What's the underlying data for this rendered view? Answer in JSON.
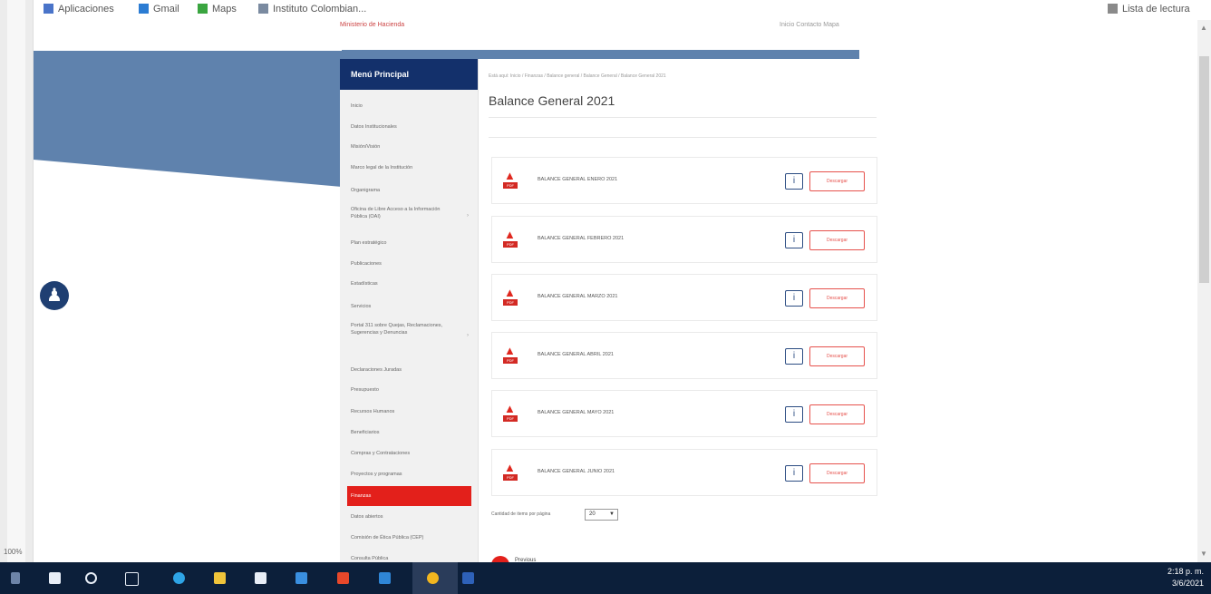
{
  "bookmarks": [
    {
      "label": "Aplicaciones",
      "icon": "apps-grid-icon",
      "color": "#4a74c9"
    },
    {
      "label": "Gmail",
      "icon": "gmail-icon",
      "color": "#2b7cd3"
    },
    {
      "label": "Maps",
      "icon": "maps-icon",
      "color": "#3aa540"
    },
    {
      "label": "Instituto Colombian...",
      "icon": "bookmark-site-icon",
      "color": "#7a8aa0"
    }
  ],
  "reading_list": "Lista de lectura",
  "zoom": "100%",
  "header": {
    "site_link": "Ministerio de Hacienda",
    "top_links": "Inicio   Contacto   Mapa"
  },
  "sidebar": {
    "title": "Menú Principal",
    "items": [
      {
        "label": "Inicio",
        "has_arrow": false
      },
      {
        "label": "Datos Institucionales",
        "has_arrow": false
      },
      {
        "label": "Misión/Visión",
        "has_arrow": false
      },
      {
        "label": "Marco legal de la Institución",
        "has_arrow": false
      },
      {
        "label": "Organigrama",
        "has_arrow": false
      },
      {
        "label": "Oficina de Libre Acceso a la Información Pública (OAI)",
        "has_arrow": true
      },
      {
        "label": "Plan estratégico",
        "has_arrow": false
      },
      {
        "label": "Publicaciones",
        "has_arrow": false
      },
      {
        "label": "Estadísticas",
        "has_arrow": false
      },
      {
        "label": "Servicios",
        "has_arrow": false
      },
      {
        "label": "Portal 311 sobre Quejas, Reclamaciones, Sugerencias y Denuncias",
        "has_arrow": true
      },
      {
        "label": "Declaraciones Juradas",
        "has_arrow": false
      },
      {
        "label": "Presupuesto",
        "has_arrow": false
      },
      {
        "label": "Recursos Humanos",
        "has_arrow": false
      },
      {
        "label": "Beneficiarios",
        "has_arrow": false
      },
      {
        "label": "Compras y Contrataciones",
        "has_arrow": false
      },
      {
        "label": "Proyectos y programas",
        "has_arrow": false
      },
      {
        "label": "Finanzas",
        "has_arrow": false,
        "active": true
      },
      {
        "label": "Datos abiertos",
        "has_arrow": false
      },
      {
        "label": "Comisión de Ética Pública (CEP)",
        "has_arrow": false
      },
      {
        "label": "Consulta Pública",
        "has_arrow": false
      }
    ]
  },
  "main": {
    "breadcrumb": "Está aquí: Inicio / Finanzas / Balance general / Balance General / Balance General 2021",
    "title": "Balance General 2021",
    "documents": [
      {
        "name": "BALANCE GENERAL ENERO 2021"
      },
      {
        "name": "BALANCE GENERAL FEBRERO 2021"
      },
      {
        "name": "BALANCE GENERAL MARZO 2021"
      },
      {
        "name": "BALANCE GENERAL ABRIL 2021"
      },
      {
        "name": "BALANCE GENERAL MAYO 2021"
      },
      {
        "name": "BALANCE GENERAL JUNIO 2021"
      }
    ],
    "pdf_label": "PDF",
    "info_label": "i",
    "download_label": "Descargar",
    "per_page_label": "Cantidad de items por página",
    "per_page_value": "20",
    "prev_label": "Previous"
  },
  "taskbar": {
    "time": "2:18 p. m.",
    "date": "3/6/2021",
    "icons": [
      {
        "name": "windows-start-icon",
        "color": "#e8eef7"
      },
      {
        "name": "search-icon",
        "color": "#e8eef7"
      },
      {
        "name": "task-view-icon",
        "color": "#e8eef7"
      },
      {
        "name": "edge-icon",
        "color": "#2ea4e6"
      },
      {
        "name": "file-explorer-icon",
        "color": "#f0c43a"
      },
      {
        "name": "store-icon",
        "color": "#e8eef7"
      },
      {
        "name": "mail-icon",
        "color": "#3a8fe0"
      },
      {
        "name": "office-icon",
        "color": "#e8482a"
      },
      {
        "name": "outlook-icon",
        "color": "#2f86d6"
      },
      {
        "name": "chrome-icon",
        "color": "#f2b61f"
      },
      {
        "name": "word-icon",
        "color": "#2e61b8"
      }
    ]
  }
}
